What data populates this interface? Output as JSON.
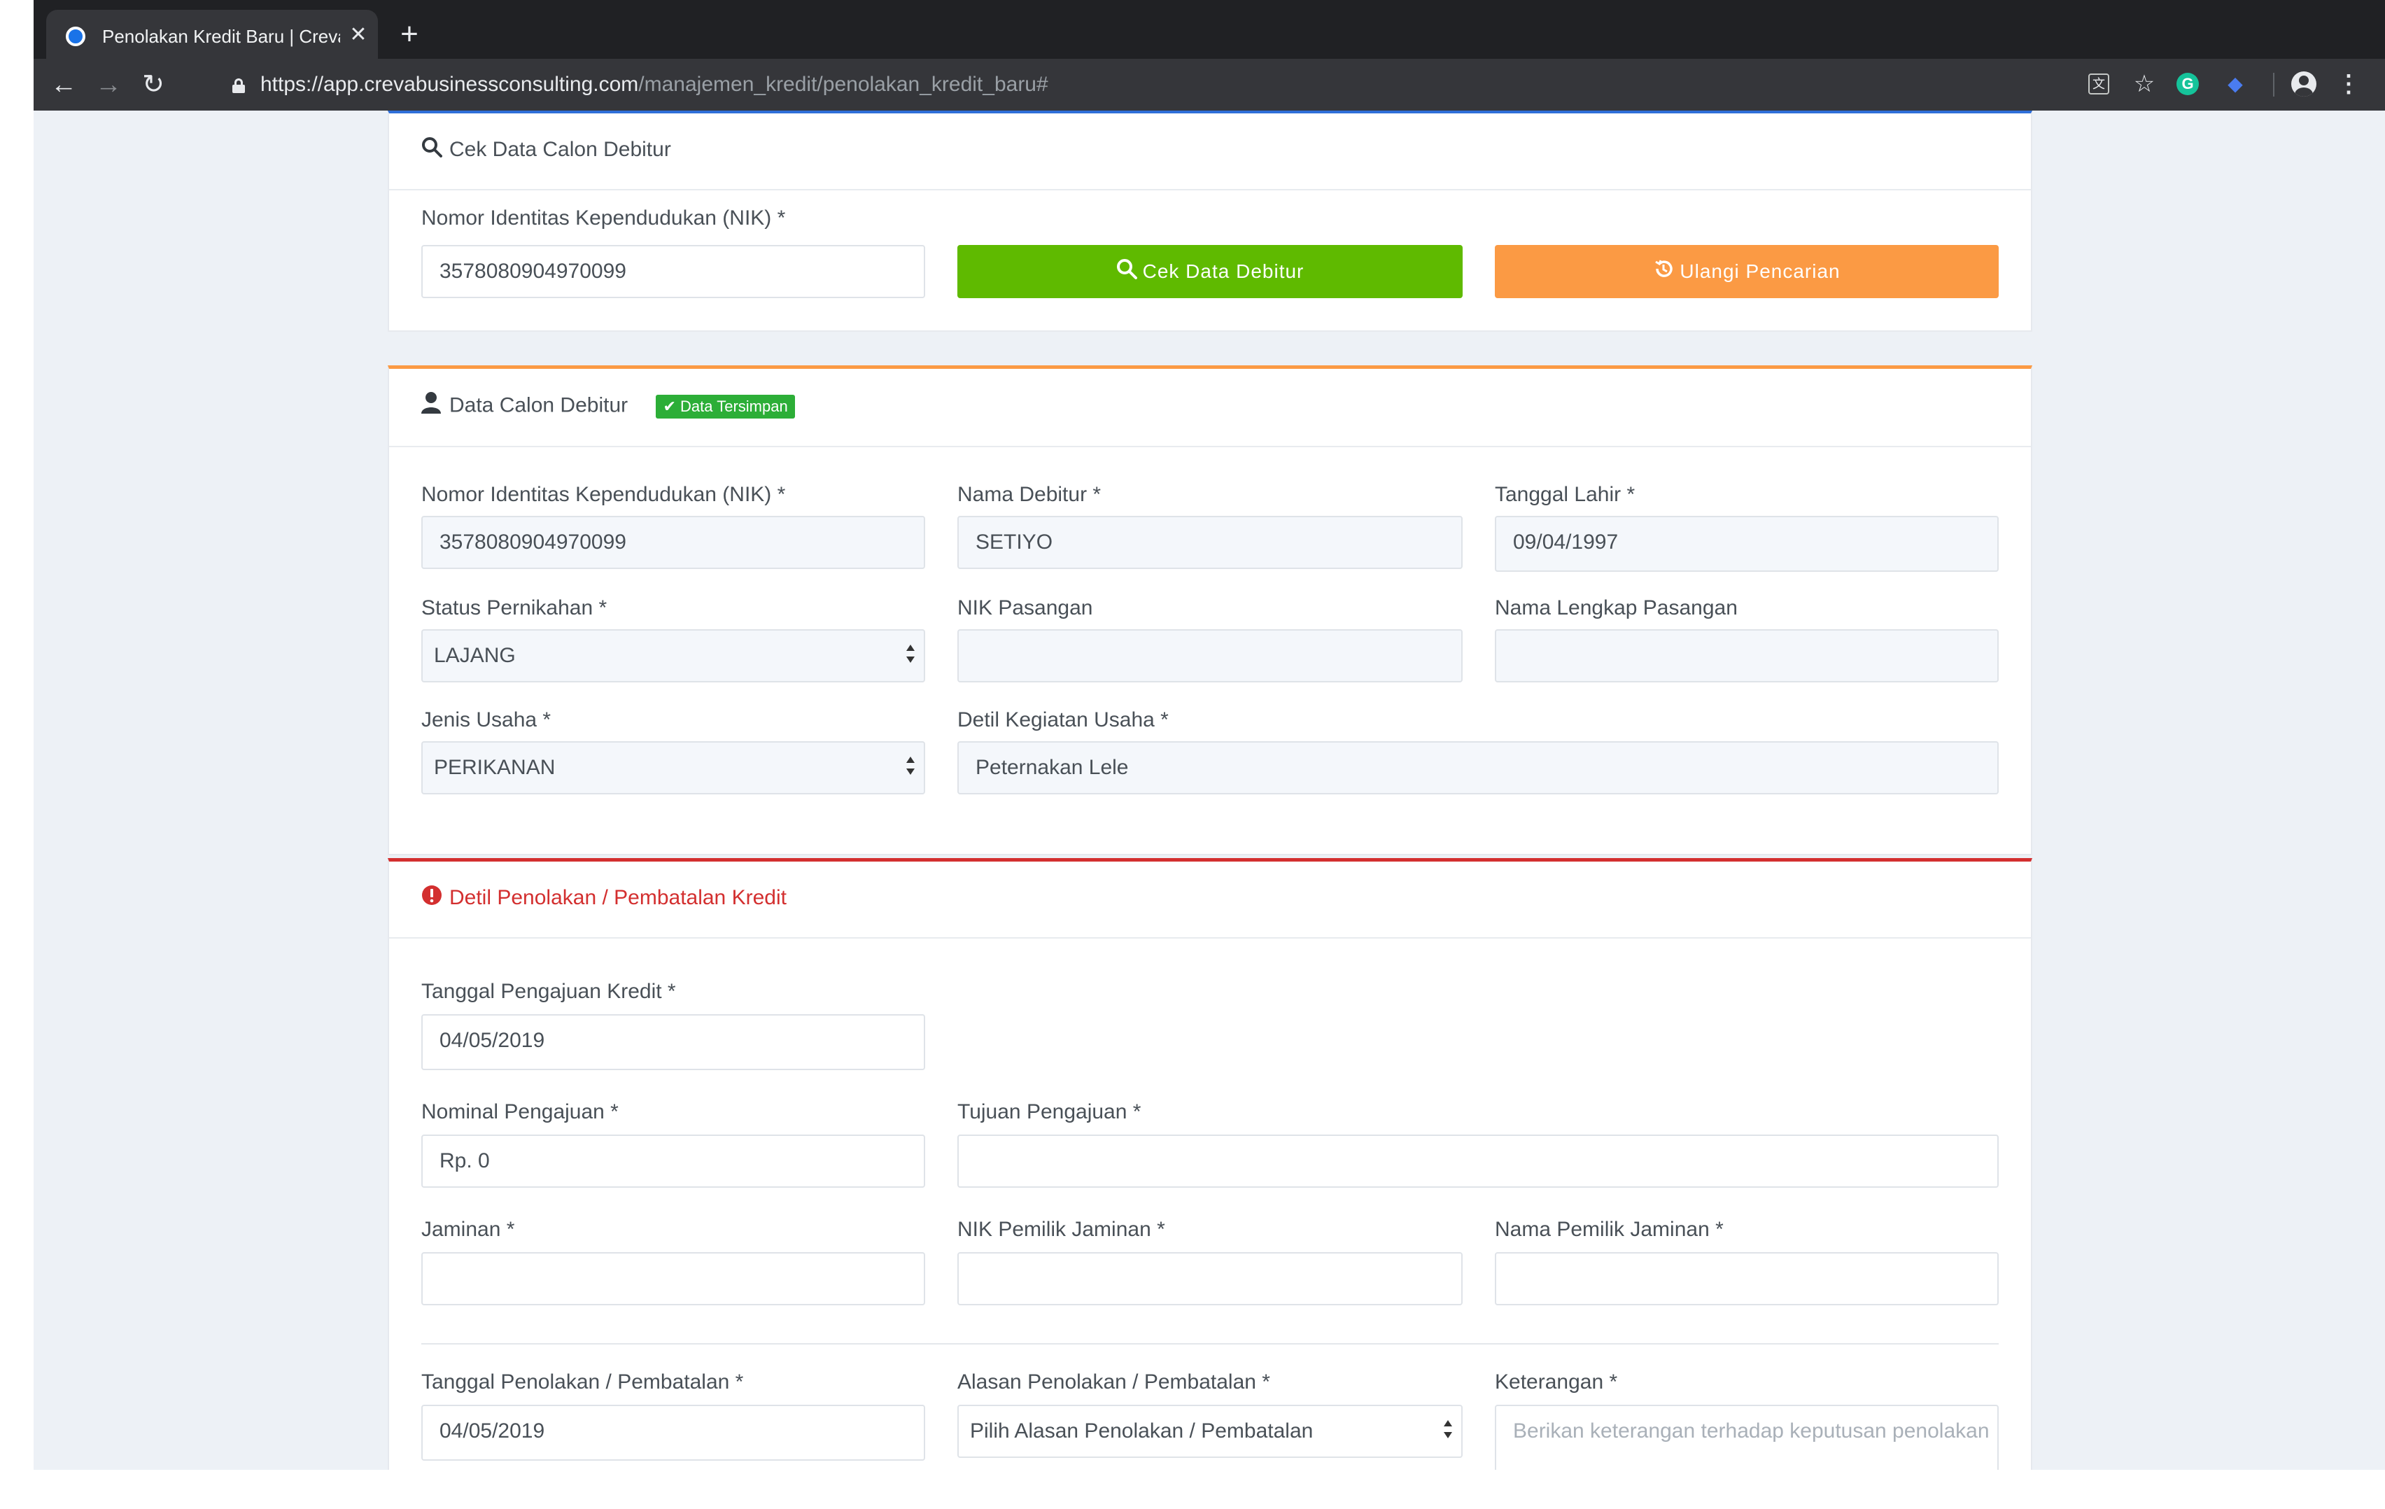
{
  "browser": {
    "tab_title": "Penolakan Kredit Baru | Creva",
    "tab_close": "✕",
    "new_tab": "+",
    "url_host": "https://app.crevabusinessconsulting.com",
    "url_path": "/manajemen_kredit/penolakan_kredit_baru#"
  },
  "cek_data": {
    "title": "Cek Data Calon Debitur",
    "nik_label": "Nomor Identitas Kependudukan (NIK) *",
    "nik_value": "3578080904970099",
    "cek_button": "Cek Data Debitur",
    "ulangi_button": "Ulangi Pencarian"
  },
  "data_calon": {
    "title": "Data Calon Debitur",
    "badge": "Data Tersimpan",
    "nik_label": "Nomor Identitas Kependudukan (NIK) *",
    "nik_value": "3578080904970099",
    "nama_label": "Nama Debitur *",
    "nama_value": "SETIYO",
    "tanggal_lahir_label": "Tanggal Lahir *",
    "tanggal_lahir_value": "09/04/1997",
    "status_label": "Status Pernikahan *",
    "status_value": "LAJANG",
    "nik_pasangan_label": "NIK Pasangan",
    "nik_pasangan_value": "",
    "nama_pasangan_label": "Nama Lengkap Pasangan",
    "nama_pasangan_value": "",
    "jenis_usaha_label": "Jenis Usaha *",
    "jenis_usaha_value": "PERIKANAN",
    "detil_kegiatan_label": "Detil Kegiatan Usaha *",
    "detil_kegiatan_value": "Peternakan Lele"
  },
  "penolakan": {
    "title": "Detil Penolakan / Pembatalan Kredit",
    "tanggal_pengajuan_label": "Tanggal Pengajuan Kredit *",
    "tanggal_pengajuan_value": "04/05/2019",
    "nominal_label": "Nominal Pengajuan *",
    "nominal_value": "Rp. 0",
    "tujuan_label": "Tujuan Pengajuan *",
    "tujuan_value": "",
    "jaminan_label": "Jaminan *",
    "jaminan_value": "",
    "nik_pemilik_label": "NIK Pemilik Jaminan *",
    "nik_pemilik_value": "",
    "nama_pemilik_label": "Nama Pemilik Jaminan *",
    "nama_pemilik_value": "",
    "tanggal_penolakan_label": "Tanggal Penolakan / Pembatalan *",
    "tanggal_penolakan_value": "04/05/2019",
    "alasan_label": "Alasan Penolakan / Pembatalan *",
    "alasan_value": "Pilih Alasan Penolakan / Pembatalan",
    "keterangan_label": "Keterangan *",
    "keterangan_placeholder": "Berikan keterangan terhadap keputusan penolakan"
  },
  "colors": {
    "chrome_dark": "#202124",
    "chrome_toolbar": "#35363a",
    "page_bg": "#edf1f6",
    "accent_blue": "#2f6fd9",
    "accent_orange": "#fb9a44",
    "accent_red": "#d32f2f",
    "button_green": "#5fba00",
    "button_orange": "#fb9a44",
    "badge_green": "#2cae37"
  }
}
